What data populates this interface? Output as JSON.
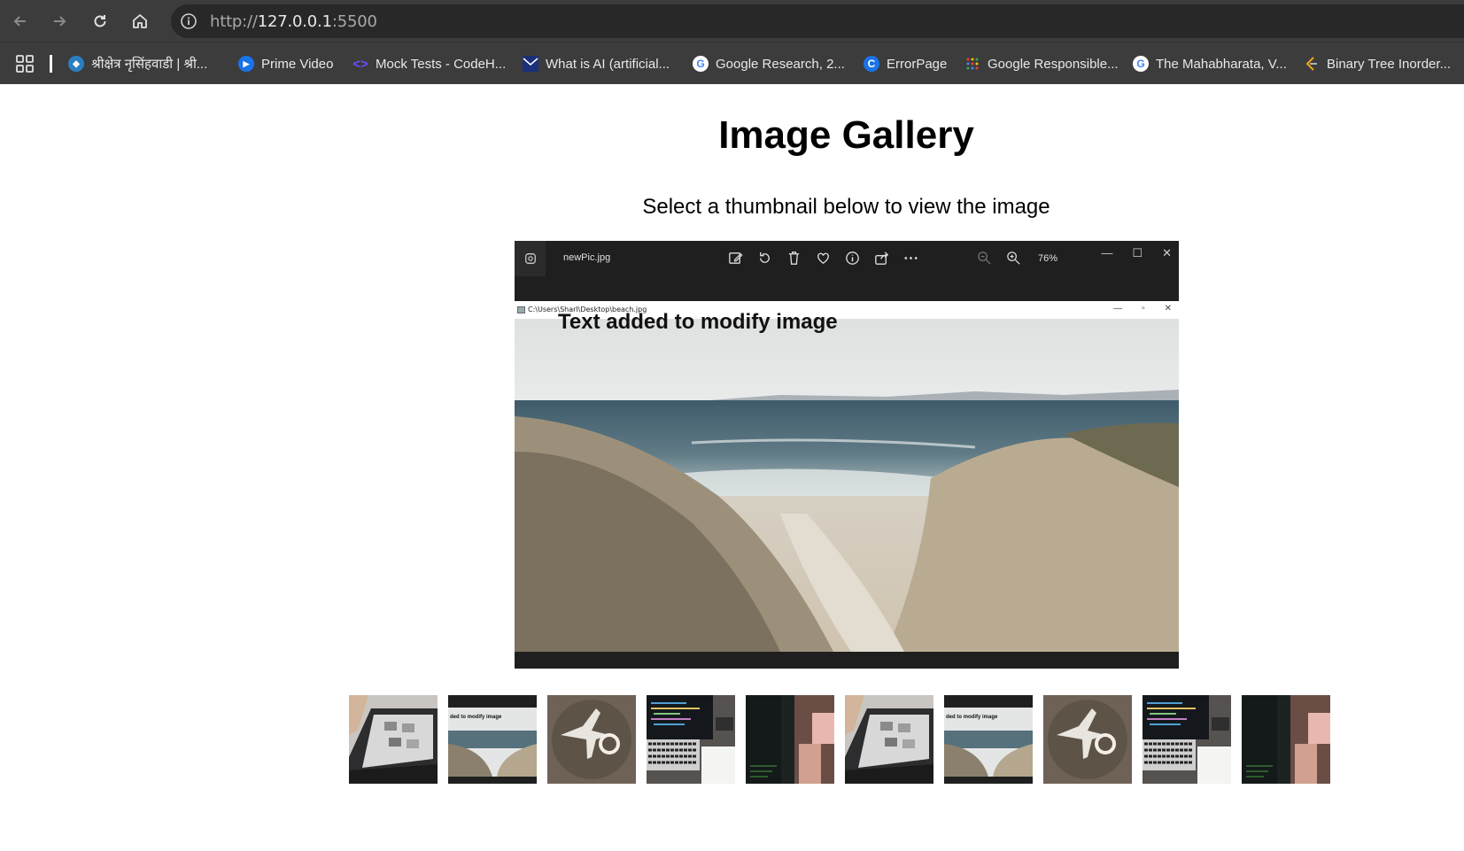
{
  "browser": {
    "url_scheme": "http://",
    "url_host": "127.0.0.1",
    "url_port": ":5500",
    "bookmarks": [
      {
        "label": "श्रीक्षेत्र नृसिंहवाडी | श्री...",
        "icon": "drupal-icon"
      },
      {
        "label": "Prime Video",
        "icon": "prime-video-icon"
      },
      {
        "label": "Mock Tests - CodeH...",
        "icon": "codehelp-icon"
      },
      {
        "label": "What is AI (artificial...",
        "icon": "mail-icon"
      },
      {
        "label": "Google Research, 2...",
        "icon": "google-icon"
      },
      {
        "label": "ErrorPage",
        "icon": "c-letter-icon"
      },
      {
        "label": "Google Responsible...",
        "icon": "dots-icon"
      },
      {
        "label": "The Mahabharata, V...",
        "icon": "google-icon"
      },
      {
        "label": "Binary Tree Inorder...",
        "icon": "leetcode-icon"
      }
    ]
  },
  "page": {
    "title": "Image Gallery",
    "subtitle": "Select a thumbnail below to view the image"
  },
  "main_image": {
    "viewer_filename": "newPic.jpg",
    "viewer_zoom": "76%",
    "inner_path": "C:\\Users\\Sharl\\Desktop\\beach.jpg",
    "overlay_text": "Text added to modify image"
  },
  "thumbnails": [
    {
      "content": "laptop-photo-editing"
    },
    {
      "content": "beach-with-text",
      "caption": "ded to modify image"
    },
    {
      "content": "airplane-logo-on-stone"
    },
    {
      "content": "laptop-code-desk"
    },
    {
      "content": "dark-monitor-code"
    },
    {
      "content": "laptop-photo-editing"
    },
    {
      "content": "beach-with-text",
      "caption": "ded to modify image"
    },
    {
      "content": "airplane-logo-on-stone"
    },
    {
      "content": "laptop-code-desk"
    },
    {
      "content": "dark-monitor-code"
    }
  ],
  "colors": {
    "chrome_bg": "#3c3c3c",
    "omnibox_bg": "#282828",
    "viewer_bg": "#1f1f1f"
  }
}
